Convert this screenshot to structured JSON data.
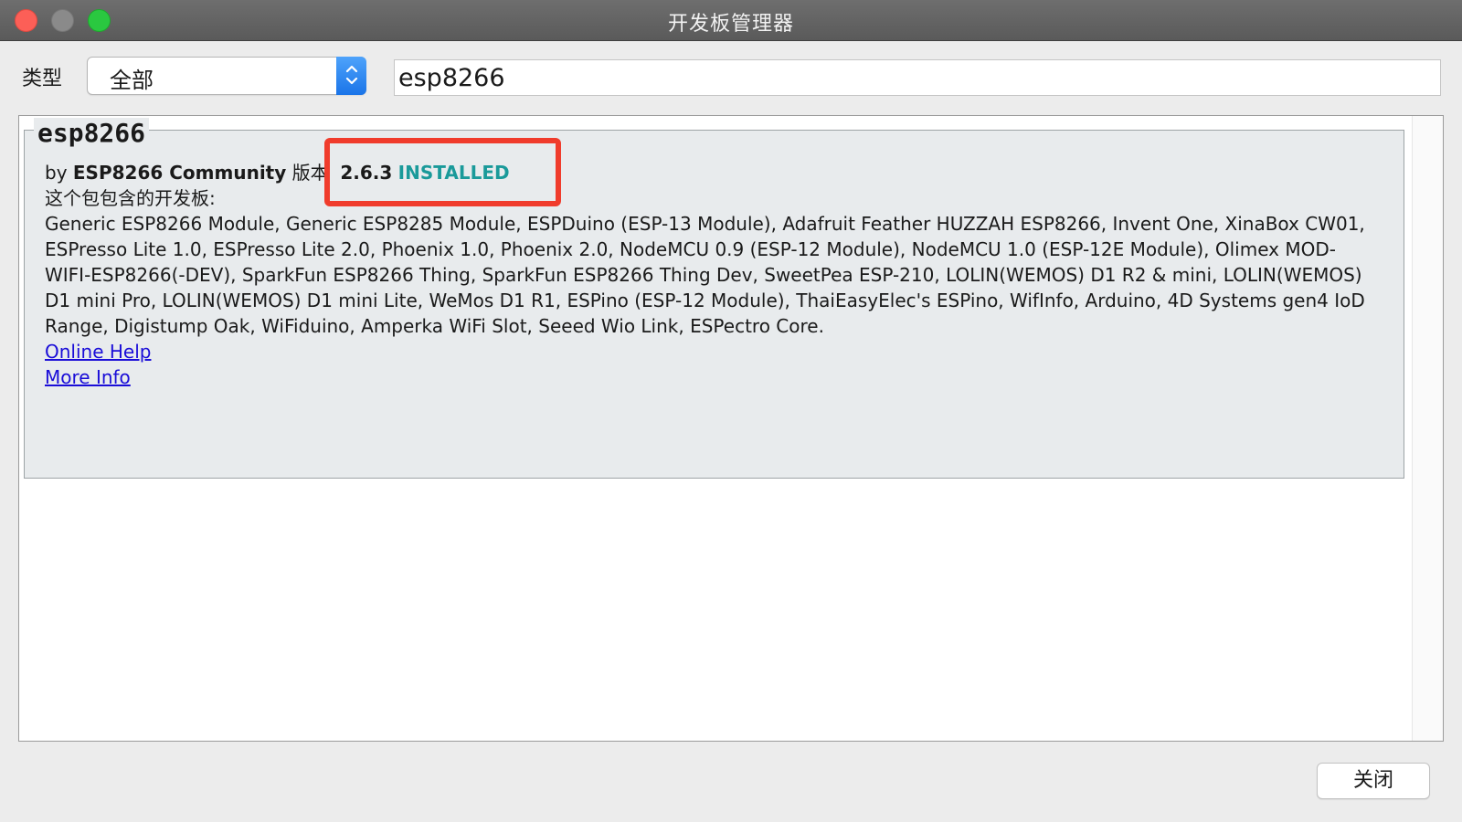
{
  "window": {
    "title": "开发板管理器"
  },
  "filter": {
    "type_label": "类型",
    "type_selected": "全部",
    "search_value": "esp8266"
  },
  "package": {
    "name": "esp8266",
    "by_prefix": "by ",
    "author": "ESP8266 Community",
    "version_label": " 版本",
    "version": "2.6.3",
    "status": "INSTALLED",
    "boards_heading": "这个包包含的开发板:",
    "boards_list": "Generic ESP8266 Module, Generic ESP8285 Module, ESPDuino (ESP-13 Module), Adafruit Feather HUZZAH ESP8266, Invent One, XinaBox CW01, ESPresso Lite 1.0, ESPresso Lite 2.0, Phoenix 1.0, Phoenix 2.0, NodeMCU 0.9 (ESP-12 Module), NodeMCU 1.0 (ESP-12E Module), Olimex MOD-WIFI-ESP8266(-DEV), SparkFun ESP8266 Thing, SparkFun ESP8266 Thing Dev, SweetPea ESP-210, LOLIN(WEMOS) D1 R2 & mini, LOLIN(WEMOS) D1 mini Pro, LOLIN(WEMOS) D1 mini Lite, WeMos D1 R1, ESPino (ESP-12 Module), ThaiEasyElec's ESPino, WifInfo, Arduino, 4D Systems gen4 IoD Range, Digistump Oak, WiFiduino, Amperka WiFi Slot, Seeed Wio Link, ESPectro Core.",
    "online_help_label": "Online Help",
    "more_info_label": "More Info"
  },
  "footer": {
    "close_label": "关闭"
  },
  "colors": {
    "installed": "#1a9a9a",
    "highlight": "#f03c2c",
    "link": "#1a0dd8"
  }
}
